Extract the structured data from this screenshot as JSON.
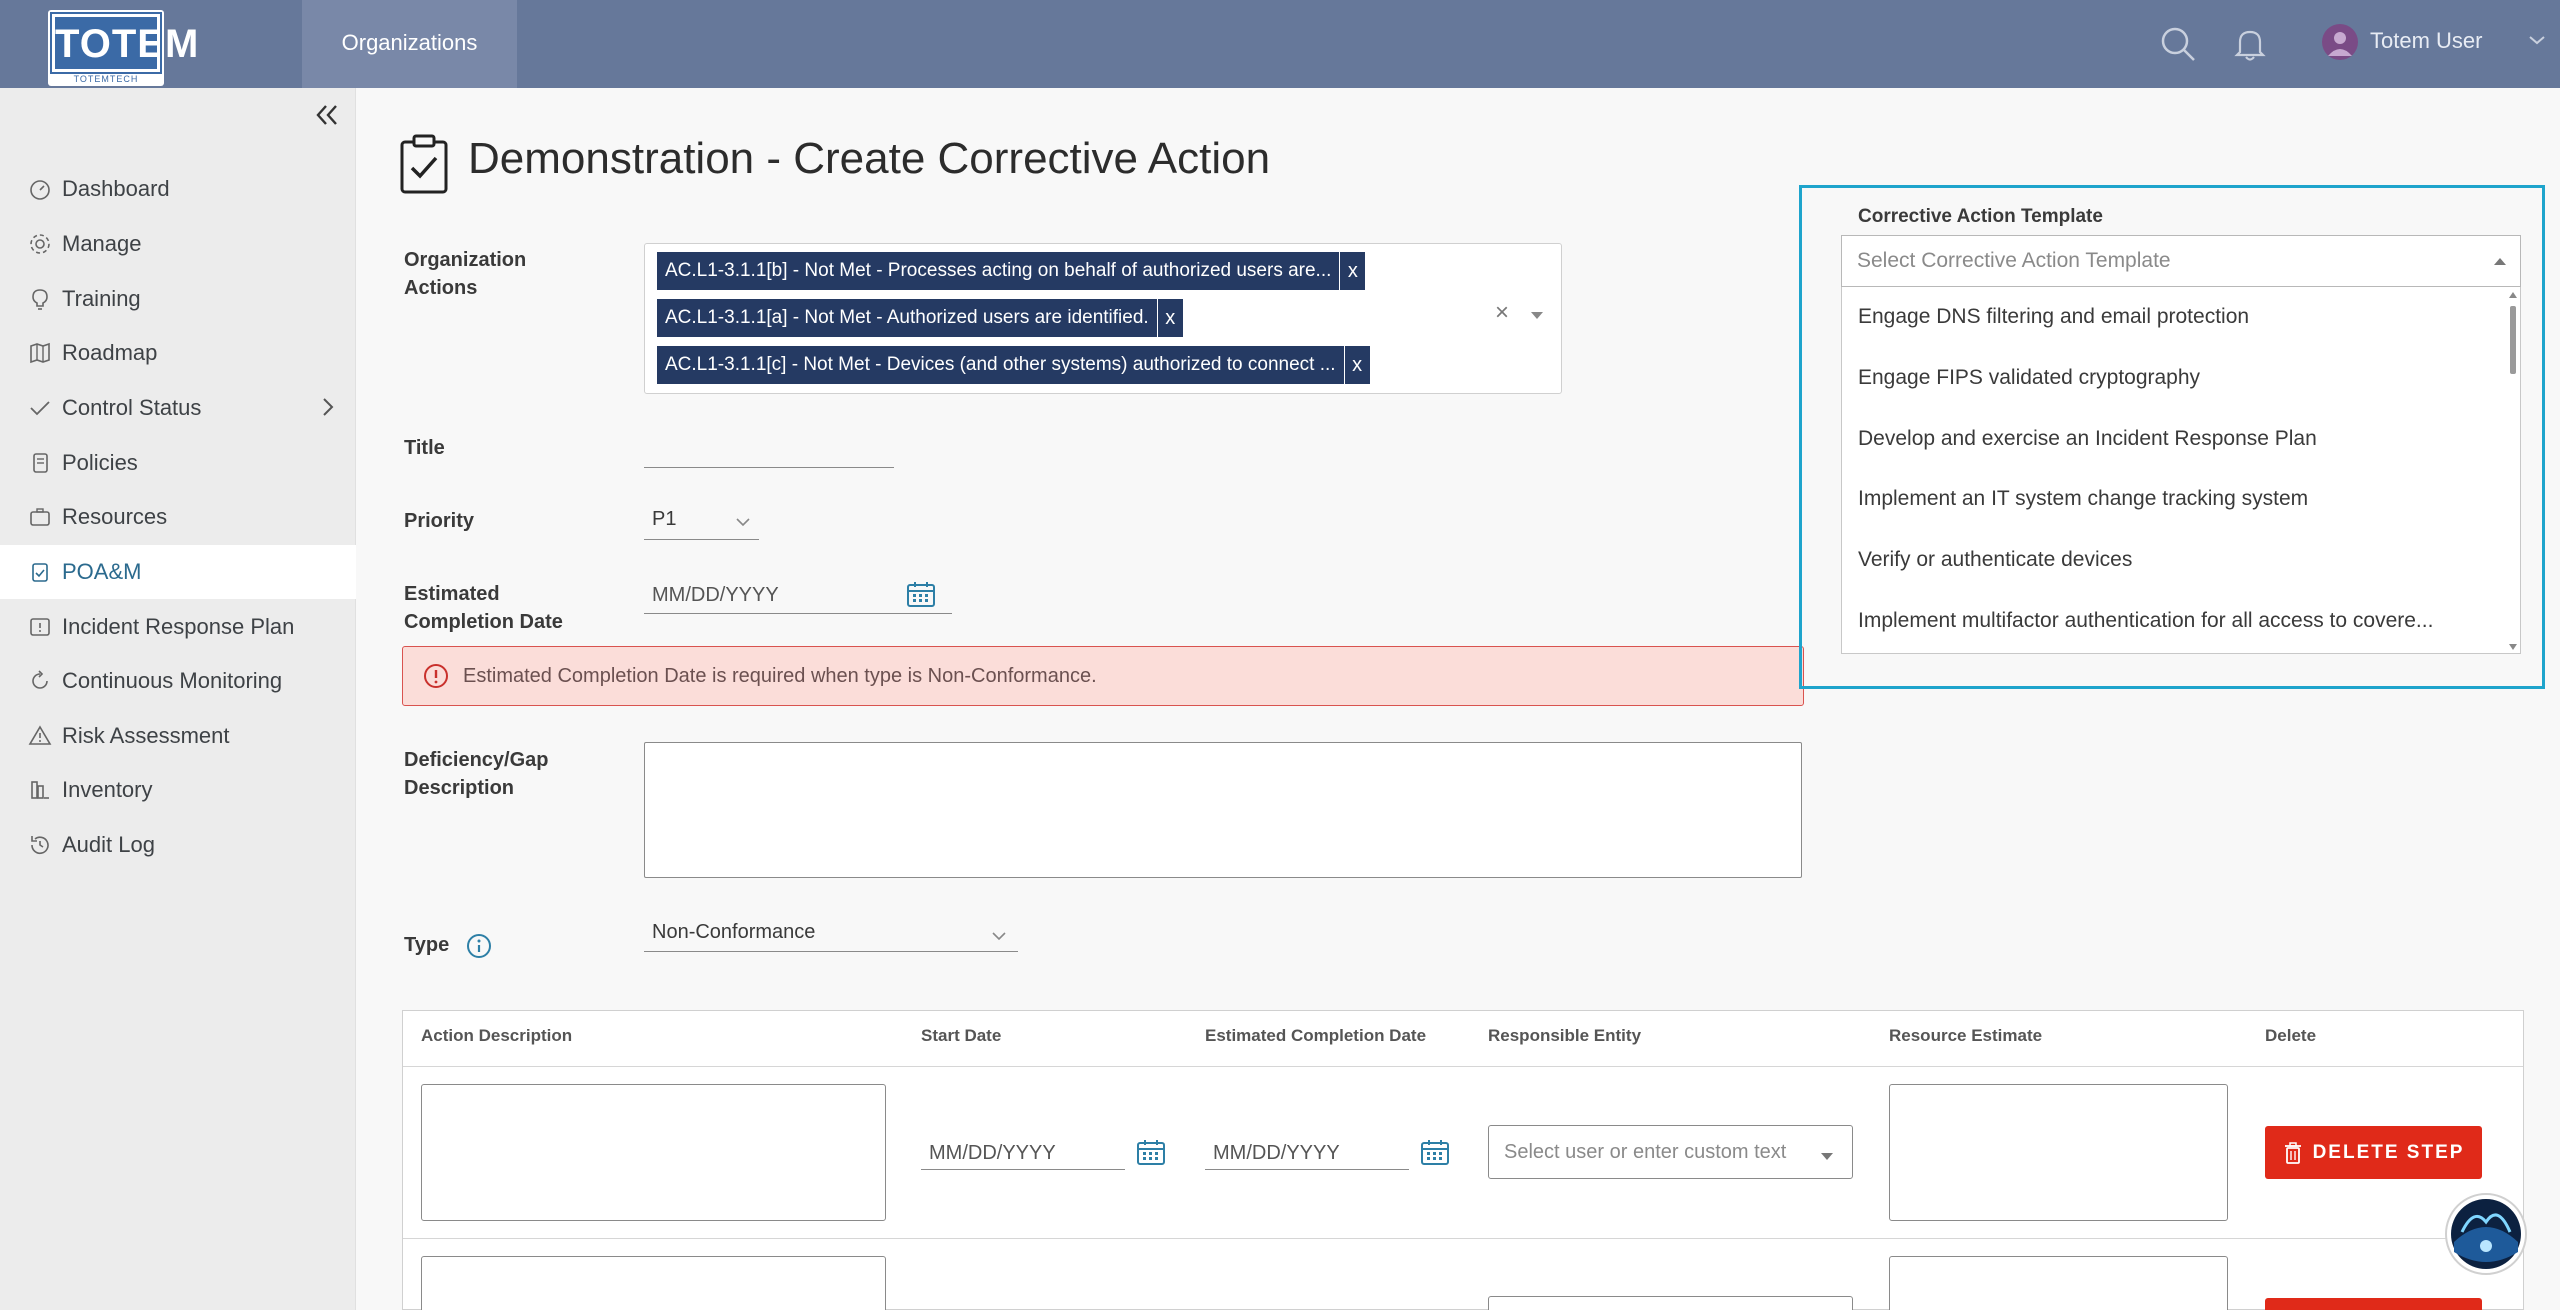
{
  "header": {
    "logo_text": "TOTEM",
    "logo_subtext": "TOTEMTECH",
    "nav_tab": "Organizations",
    "user_name": "Totem User"
  },
  "sidebar": {
    "items": [
      {
        "label": "Dashboard",
        "icon": "dashboard-icon"
      },
      {
        "label": "Manage",
        "icon": "gear-icon"
      },
      {
        "label": "Training",
        "icon": "lightbulb-icon"
      },
      {
        "label": "Roadmap",
        "icon": "map-icon"
      },
      {
        "label": "Control Status",
        "icon": "check-icon"
      },
      {
        "label": "Policies",
        "icon": "scroll-icon"
      },
      {
        "label": "Resources",
        "icon": "briefcase-icon"
      },
      {
        "label": "POA&M",
        "icon": "clipboard-check-icon",
        "active": true
      },
      {
        "label": "Incident Response Plan",
        "icon": "alert-box-icon"
      },
      {
        "label": "Continuous Monitoring",
        "icon": "cycle-icon"
      },
      {
        "label": "Risk Assessment",
        "icon": "warning-icon"
      },
      {
        "label": "Inventory",
        "icon": "inventory-icon"
      },
      {
        "label": "Audit Log",
        "icon": "history-icon"
      }
    ]
  },
  "page": {
    "title": "Demonstration - Create Corrective Action"
  },
  "form": {
    "org_actions_label": "Organization Actions",
    "org_actions": [
      "AC.L1-3.1.1[b] - Not Met - Processes acting on behalf of authorized users are...",
      "AC.L1-3.1.1[a] - Not Met - Authorized users are identified.",
      "AC.L1-3.1.1[c] - Not Met - Devices (and other systems) authorized to connect ..."
    ],
    "chip_remove": "x",
    "clear_all": "×",
    "title_label": "Title",
    "title_value": "",
    "priority_label": "Priority",
    "priority_value": "P1",
    "ecd_label": "Estimated Completion Date",
    "ecd_placeholder": "MM/DD/YYYY",
    "error_text": "Estimated Completion Date is required when type is Non-Conformance.",
    "deficiency_label": "Deficiency/Gap Description",
    "deficiency_value": "",
    "type_label": "Type",
    "type_value": "Non-Conformance"
  },
  "template": {
    "label": "Corrective Action Template",
    "placeholder": "Select Corrective Action Template",
    "options": [
      "Engage DNS filtering and email protection",
      "Engage FIPS validated cryptography",
      "Develop and exercise an Incident Response Plan",
      "Implement an IT system change tracking system",
      "Verify or authenticate devices",
      "Implement multifactor authentication for all access to covere..."
    ]
  },
  "steps_table": {
    "headers": [
      "Action Description",
      "Start Date",
      "Estimated Completion Date",
      "Responsible Entity",
      "Resource Estimate",
      "Delete"
    ],
    "date_placeholder": "MM/DD/YYYY",
    "entity_placeholder": "Select user or enter custom text",
    "delete_label": "DELETE STEP"
  },
  "colors": {
    "topbar": "#66789a",
    "chip": "#253a63",
    "delete": "#e02a19",
    "highlight": "#1ea4cc",
    "error_bg": "#fbddd9"
  }
}
